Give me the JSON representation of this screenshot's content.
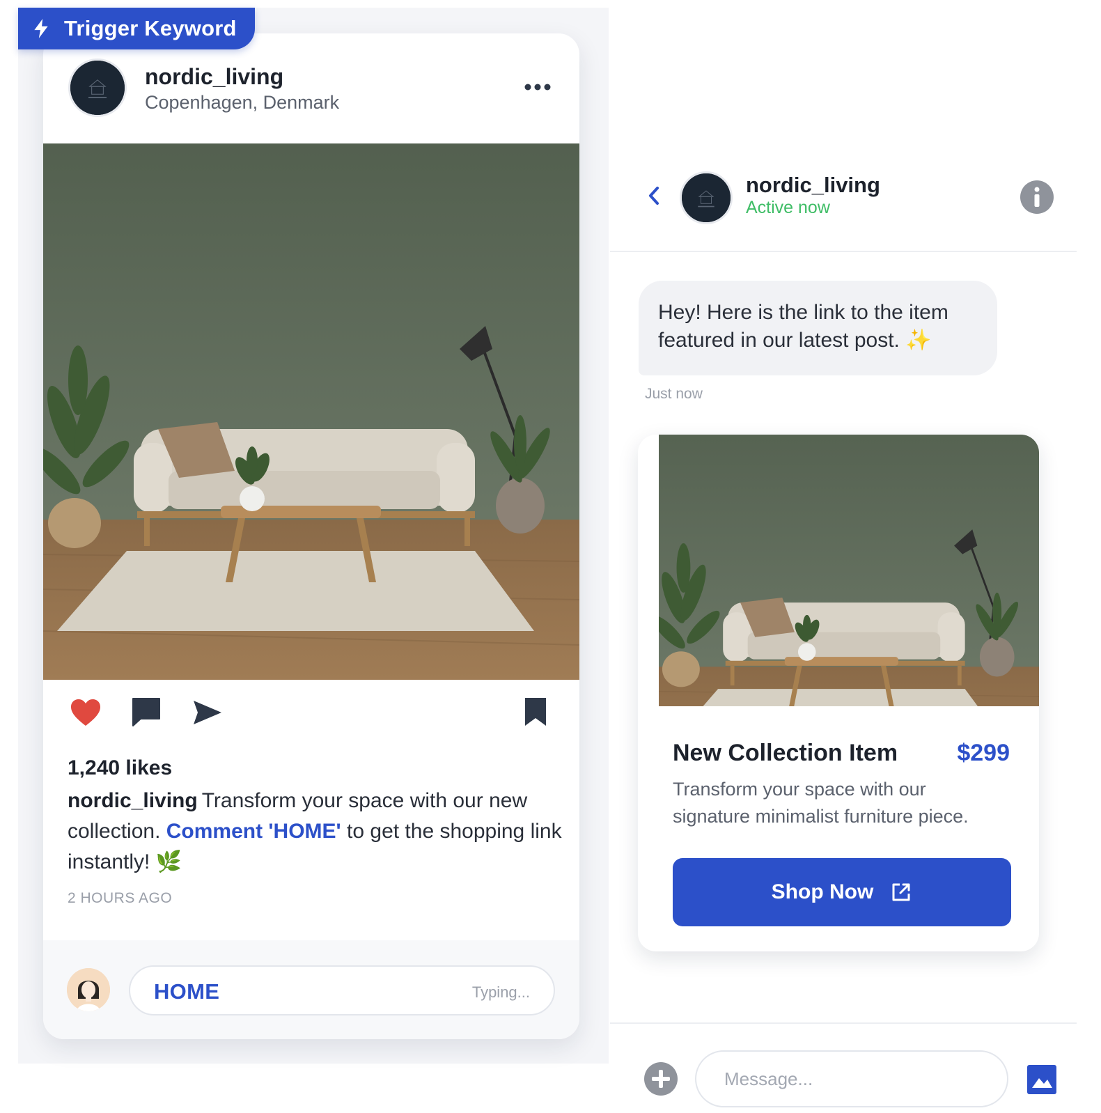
{
  "trigger_badge": {
    "label": "Trigger Keyword",
    "icon": "lightning-icon"
  },
  "post": {
    "username": "nordic_living",
    "location": "Copenhagen, Denmark",
    "likes": "1,240 likes",
    "caption_user": "nordic_living",
    "caption_before": "Transform your space with our new collection. ",
    "caption_keyword": "Comment 'HOME'",
    "caption_after": " to get the shopping link instantly! 🌿",
    "time": "2 HOURS AGO",
    "comment_text": "HOME",
    "typing": "Typing..."
  },
  "chat": {
    "username": "nordic_living",
    "status": "Active now",
    "message": "Hey! Here is the link to the item featured in our latest post. ✨",
    "message_time": "Just now",
    "product": {
      "title": "New Collection Item",
      "price": "$299",
      "description": "Transform your space with our signature minimalist furniture piece.",
      "button_label": "Shop Now"
    },
    "composer_placeholder": "Message..."
  },
  "colors": {
    "accent": "#2c50c9",
    "online": "#3fbd66",
    "like": "#e0493f",
    "dark_icon": "#2e3848"
  }
}
